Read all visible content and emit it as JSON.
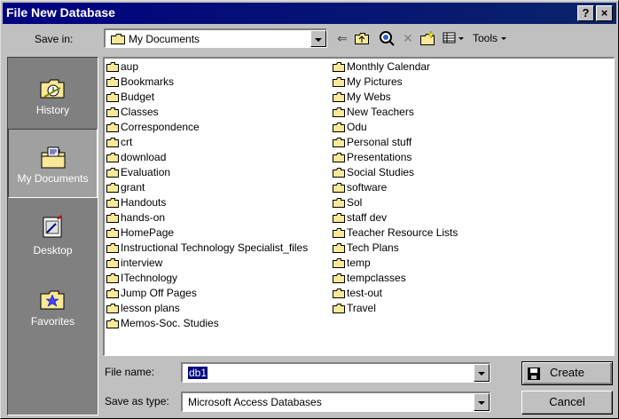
{
  "window": {
    "title": "File New Database",
    "help_label": "?",
    "close_label": "×"
  },
  "toolbar": {
    "save_in_label": "Save in:",
    "save_in_value": "My Documents",
    "tools_label": "Tools"
  },
  "places": [
    {
      "label": "History",
      "icon": "history-icon"
    },
    {
      "label": "My Documents",
      "icon": "my-documents-icon",
      "active": true
    },
    {
      "label": "Desktop",
      "icon": "desktop-icon"
    },
    {
      "label": "Favorites",
      "icon": "favorites-icon"
    }
  ],
  "files": {
    "column1": [
      "aup",
      "Bookmarks",
      "Budget",
      "Classes",
      "Correspondence",
      "crt",
      "download",
      "Evaluation",
      "grant",
      "Handouts",
      "hands-on",
      "HomePage",
      "Instructional Technology Specialist_files",
      "interview",
      "ITechnology",
      "Jump Off Pages",
      "lesson plans",
      "Memos-Soc. Studies"
    ],
    "column2": [
      "Monthly Calendar",
      "My Pictures",
      "My Webs",
      "New Teachers",
      "Odu",
      "Personal stuff",
      "Presentations",
      "Social Studies",
      "software",
      "Sol",
      "staff dev",
      "Teacher Resource Lists",
      "Tech Plans",
      "temp",
      "tempclasses",
      "test-out",
      "Travel"
    ]
  },
  "form": {
    "file_name_label": "File name:",
    "file_name_value": "db1",
    "save_type_label": "Save as type:",
    "save_type_value": "Microsoft Access Databases"
  },
  "buttons": {
    "create_label": "Create",
    "cancel_label": "Cancel"
  },
  "colors": {
    "titlebar": "#000080",
    "face": "#c0c0c0",
    "folder": "#f8e898"
  }
}
